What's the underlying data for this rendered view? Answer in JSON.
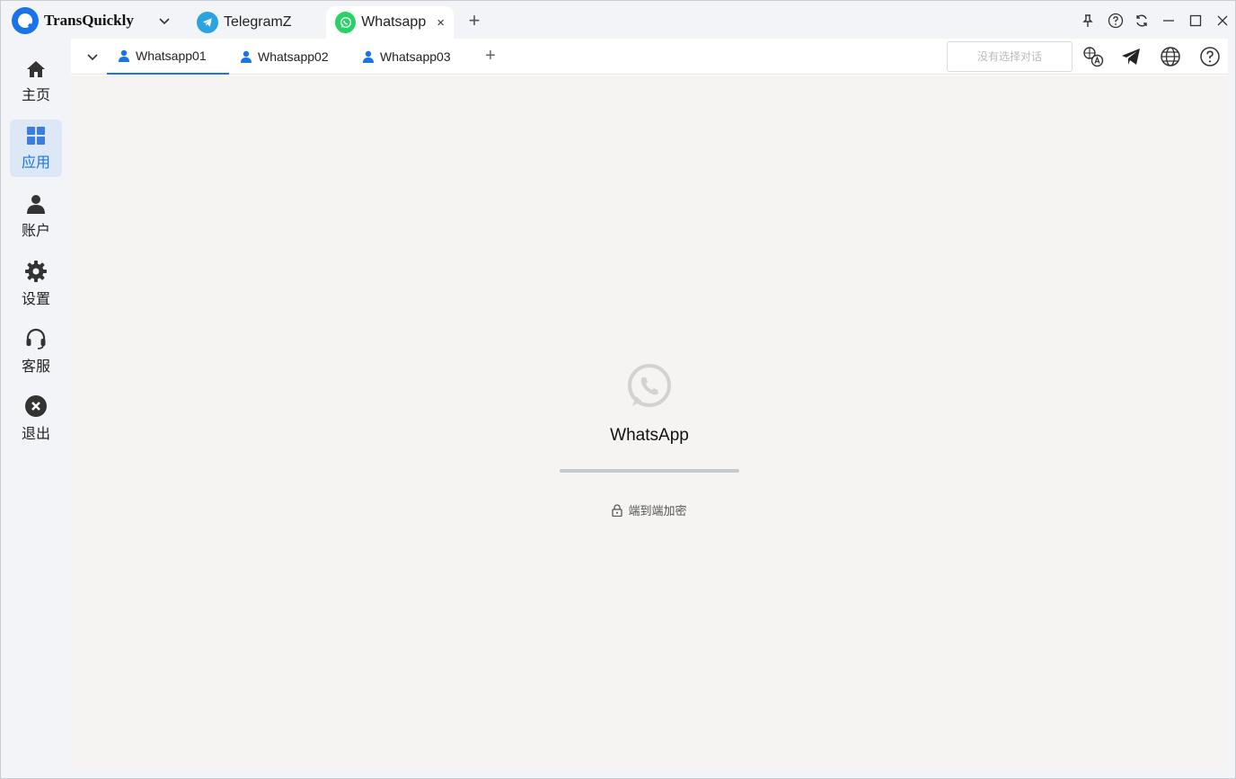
{
  "app": {
    "brand_name": "TransQuickly"
  },
  "app_tabs": [
    {
      "label": "TelegramZ",
      "icon": "telegram-icon"
    },
    {
      "label": "Whatsapp",
      "icon": "whatsapp-icon",
      "active": true,
      "close": "×"
    }
  ],
  "app_tab_add": "+",
  "window_controls": [
    "pin-icon",
    "help-icon",
    "refresh-icon",
    "minimize-icon",
    "maximize-icon",
    "close-icon"
  ],
  "sidebar": {
    "items": [
      {
        "label": "主页",
        "icon": "home-icon"
      },
      {
        "label": "应用",
        "icon": "apps-grid-icon",
        "active": true
      },
      {
        "label": "账户",
        "icon": "user-icon"
      },
      {
        "label": "设置",
        "icon": "gear-icon"
      },
      {
        "label": "客服",
        "icon": "headset-icon"
      },
      {
        "label": "退出",
        "icon": "exit-icon"
      }
    ]
  },
  "account_tabs": [
    {
      "label": "Whatsapp01",
      "active": true
    },
    {
      "label": "Whatsapp02"
    },
    {
      "label": "Whatsapp03"
    }
  ],
  "account_add": "+",
  "toolbar": {
    "conversation_placeholder": "没有选择对话",
    "icons": [
      "translate-icon",
      "send-icon",
      "globe-icon",
      "help-icon"
    ]
  },
  "whatsapp_pane": {
    "title": "WhatsApp",
    "encryption_text": "端到端加密",
    "progress": 1.0
  },
  "colors": {
    "accent": "#1a73e8",
    "telegram": "#2aa3e0",
    "whatsapp": "#25d366"
  }
}
